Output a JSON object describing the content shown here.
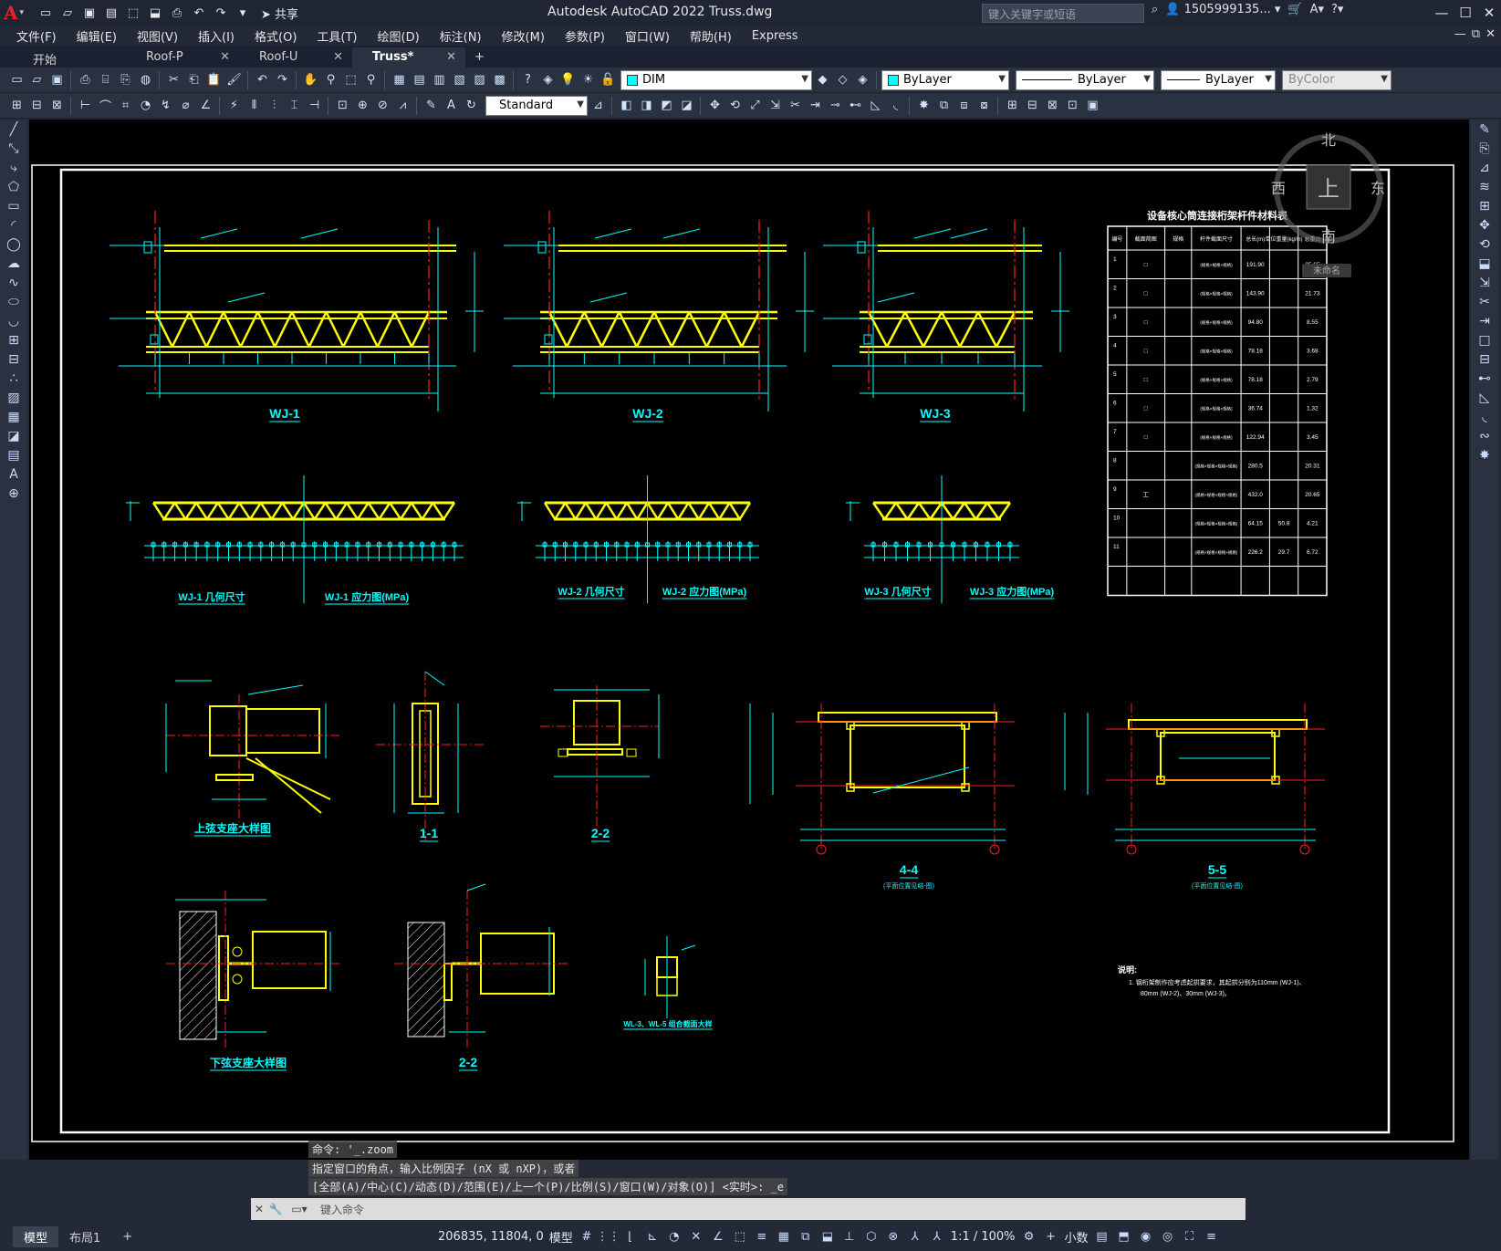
{
  "window": {
    "title": "Autodesk AutoCAD 2022    Truss.dwg",
    "search_placeholder": "键入关键字或短语",
    "user": "1505999135...",
    "share": "共享"
  },
  "menu": [
    "文件(F)",
    "编辑(E)",
    "视图(V)",
    "插入(I)",
    "格式(O)",
    "工具(T)",
    "绘图(D)",
    "标注(N)",
    "修改(M)",
    "参数(P)",
    "窗口(W)",
    "帮助(H)",
    "Express"
  ],
  "file_tabs": [
    {
      "label": "开始",
      "close": ""
    },
    {
      "label": "Roof-P",
      "close": "✕"
    },
    {
      "label": "Roof-U",
      "close": "✕"
    },
    {
      "label": "Truss*",
      "close": "✕",
      "active": true
    }
  ],
  "toolbar": {
    "layer": "DIM",
    "color": "ByLayer",
    "linetype": "ByLayer",
    "lineweight": "ByLayer",
    "plotstyle": "ByColor",
    "textstyle": "Standard"
  },
  "viewcube": {
    "north": "北",
    "south": "南",
    "east": "东",
    "west": "西",
    "top": "上",
    "wcs": "未命名"
  },
  "drawing": {
    "truss_labels": [
      "WJ-1",
      "WJ-2",
      "WJ-3"
    ],
    "geo_labels": [
      "WJ-1 几何尺寸",
      "WJ-1 应力图(MPa)",
      "WJ-2 几何尺寸",
      "WJ-2 应力图(MPa)",
      "WJ-3 几何尺寸",
      "WJ-3 应力图(MPa)"
    ],
    "detail_labels": [
      "上弦支座大样图",
      "1-1",
      "2-2",
      "4-4",
      "5-5",
      "下弦支座大样图",
      "2-2"
    ],
    "section_notes": [
      "(平面位置见结-图)",
      "(平面位置见结-图)"
    ],
    "small_detail": "WL-3、WL-5 组合截面大样",
    "table_title": "设备核心筒连接桁架杆件材料表",
    "table_headers": [
      "编号",
      "截面简图",
      "规格",
      "杆件截面尺寸",
      "总长(m)",
      "单位重量(kg/m)",
      "总重(t)"
    ],
    "table_rows": [
      [
        "1",
        "□",
        "",
        "(规格×规格×规格)",
        "191.90",
        "",
        "35.65"
      ],
      [
        "2",
        "□",
        "",
        "(规格×规格×规格)",
        "143.90",
        "",
        "21.73"
      ],
      [
        "3",
        "□",
        "",
        "(规格×规格×规格)",
        "94.80",
        "",
        "8.55"
      ],
      [
        "4",
        "□",
        "",
        "(规格×规格×规格)",
        "78.18",
        "",
        "3.68"
      ],
      [
        "5",
        "□",
        "",
        "(规格×规格×规格)",
        "78.18",
        "",
        "2.79"
      ],
      [
        "6",
        "□",
        "",
        "(规格×规格×规格)",
        "36.74",
        "",
        "1.32"
      ],
      [
        "7",
        "□",
        "",
        "(规格×规格×规格)",
        "122.94",
        "",
        "3.45"
      ],
      [
        "8",
        "",
        "",
        "(规格×规格×规格×规格)",
        "280.5",
        "",
        "20.31"
      ],
      [
        "9",
        "工",
        "",
        "(规格×规格×规格×规格)",
        "432.0",
        "",
        "20.65"
      ],
      [
        "10",
        "",
        "",
        "(规格×规格×规格×规格)",
        "64.15",
        "50.8",
        "4.21"
      ],
      [
        "11",
        "",
        "",
        "(规格×规格×规格×规格)",
        "226.2",
        "29.7",
        "6.72"
      ]
    ],
    "notes_title": "说明:",
    "notes": [
      "1. 钢桁架制作应考虑起拱要求，其起拱分别为110mm (WJ-1)、",
      "80mm (WJ-2)、30mm (WJ-3)。"
    ]
  },
  "command": {
    "history": [
      "命令: '_.zoom",
      "指定窗口的角点，输入比例因子 (nX 或 nXP)，或者",
      "[全部(A)/中心(C)/动态(D)/范围(E)/上一个(P)/比例(S)/窗口(W)/对象(O)] <实时>: _e"
    ],
    "placeholder": "键入命令"
  },
  "layouts": [
    "模型",
    "布局1"
  ],
  "status": {
    "coords": "206835, 11804, 0",
    "model": "模型",
    "scale": "1:1 / 100%",
    "units": "小数"
  },
  "colors": {
    "accent": "#00ffff",
    "truss": "#ffff00",
    "axis": "#ff2020",
    "bg": "#000000"
  }
}
